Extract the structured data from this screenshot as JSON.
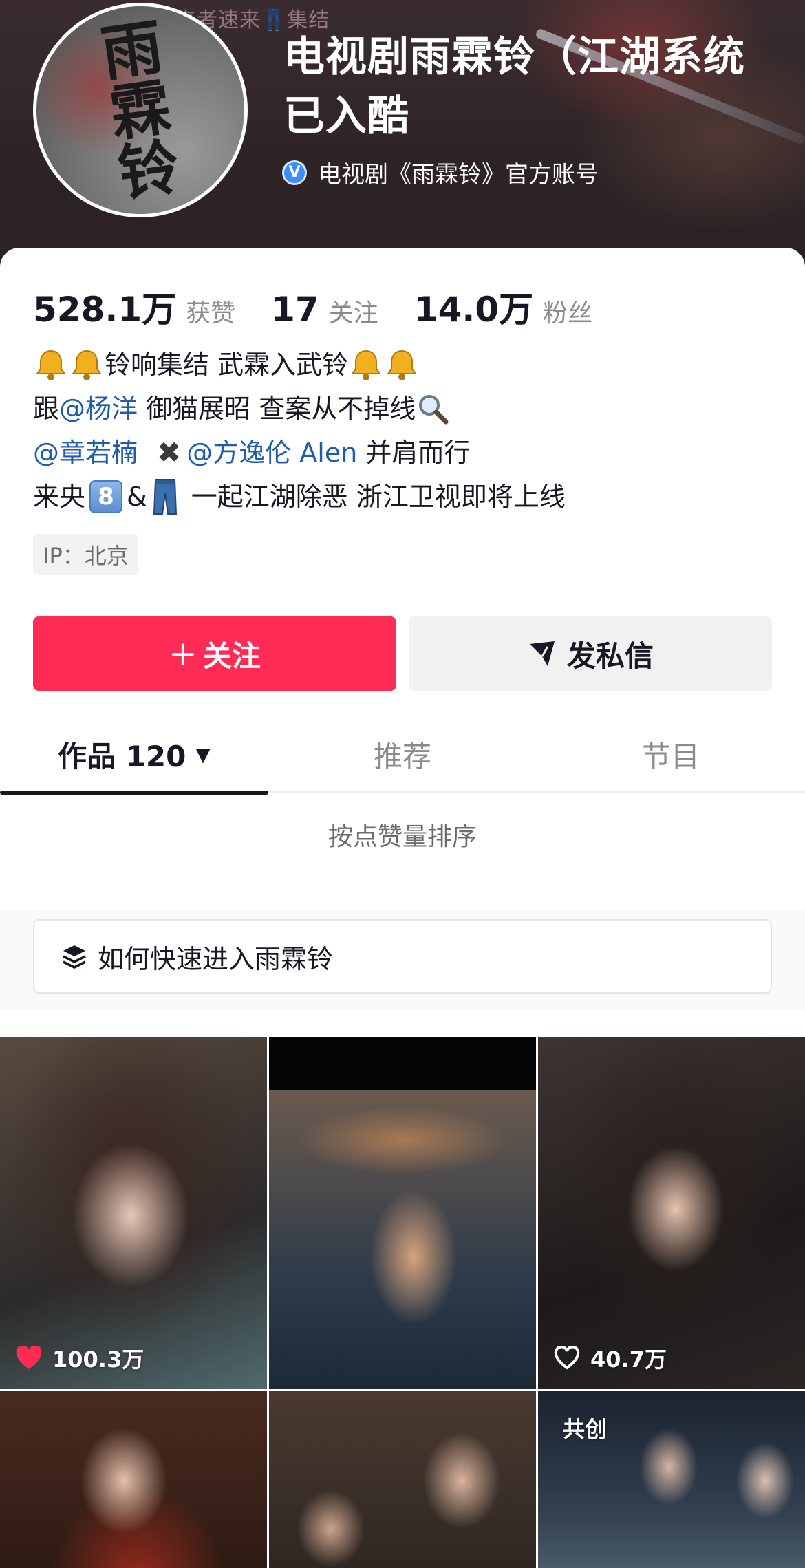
{
  "header": {
    "banner_caption": "来者速来👖集结",
    "avatar_title": [
      "雨",
      "霖",
      "铃"
    ],
    "display_name": "电视剧雨霖铃（江湖系统已入酷",
    "verify_icon": "verified-v-icon",
    "verify_text": "电视剧《雨霖铃》官方账号"
  },
  "stats": [
    {
      "value": "528.1万",
      "label": "获赞"
    },
    {
      "value": "17",
      "label": "关注"
    },
    {
      "value": "14.0万",
      "label": "粉丝"
    }
  ],
  "bio": {
    "line1_text": "铃响集结 武霖入武铃",
    "line2_prefix": "跟",
    "line2_mention": "@杨洋",
    "line2_text": " 御猫展昭 查案从不掉线",
    "line3_mention1": "@章若楠",
    "line3_cross": "✖",
    "line3_mention2": "@方逸伦 Alen",
    "line3_text": " 并肩而行",
    "line4_prefix": "来央",
    "line4_num": "8",
    "line4_amp": "&",
    "line4_text": " 一起江湖除恶 浙江卫视即将上线"
  },
  "ip_tag": "IP：北京",
  "actions": {
    "follow_plus": "+",
    "follow_label": "关注",
    "message_label": "发私信"
  },
  "tabs": [
    {
      "label": "作品 120",
      "caret": "▼",
      "active": true
    },
    {
      "label": "推荐",
      "active": false
    },
    {
      "label": "节目",
      "active": false
    }
  ],
  "sort_label": "按点赞量排序",
  "collection_label": "如何快速进入雨霖铃",
  "videos": [
    {
      "likes": "100.3万",
      "liked": true
    },
    {
      "likes": "",
      "liked": false
    },
    {
      "likes": "40.7万",
      "liked": false
    },
    {
      "likes": "",
      "liked": false
    },
    {
      "likes": "",
      "liked": false
    },
    {
      "badge": "共创"
    }
  ],
  "colors": {
    "accent": "#fe2c55",
    "mention": "#1f5dab",
    "verify": "#3c8dff"
  }
}
